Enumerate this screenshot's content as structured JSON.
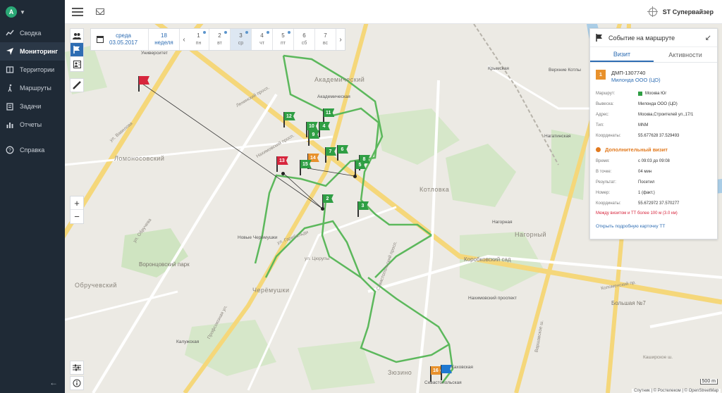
{
  "sidebar": {
    "avatar_letter": "A",
    "items": [
      {
        "label": "Сводка",
        "icon": "trend-icon"
      },
      {
        "label": "Мониторинг",
        "icon": "location-arrow-icon",
        "active": true
      },
      {
        "label": "Территории",
        "icon": "map-icon"
      },
      {
        "label": "Маршруты",
        "icon": "walker-icon"
      },
      {
        "label": "Задачи",
        "icon": "clipboard-icon"
      },
      {
        "label": "Отчеты",
        "icon": "bar-chart-icon"
      },
      {
        "label": "Справка",
        "icon": "help-icon"
      }
    ]
  },
  "topbar": {
    "user_name": "ST Супервайзер"
  },
  "date_bar": {
    "weekday": "среда",
    "date": "03.05.2017",
    "week_num": "18",
    "week_label": "неделя",
    "days": [
      {
        "num": "1",
        "name": "пн",
        "dot": true
      },
      {
        "num": "2",
        "name": "вт",
        "dot": true
      },
      {
        "num": "3",
        "name": "ср",
        "dot": true,
        "selected": true
      },
      {
        "num": "4",
        "name": "чт",
        "dot": true
      },
      {
        "num": "5",
        "name": "пт",
        "dot": true
      },
      {
        "num": "6",
        "name": "сб",
        "dot": false
      },
      {
        "num": "7",
        "name": "вс",
        "dot": false
      }
    ]
  },
  "map_labels": {
    "districts": [
      "Академический",
      "Ломоносовский",
      "Котловка",
      "Нагорный",
      "Обручевский",
      "Черёмушки",
      "Зюзино"
    ],
    "metro": [
      "Университет",
      "Академическая",
      "Новые Черёмушки",
      "Калужская",
      "Нагорная",
      "Нахимовский проспект",
      "Каховская",
      "Севастопольская",
      "Нагатинская",
      "Верхние Котлы",
      "Крымская"
    ],
    "streets": [
      "Нахимовский просп.",
      "ул. Вавилова",
      "Профсоюзная ул.",
      "Севастопольский просп.",
      "Варшавское ш.",
      "Ленинский просп.",
      "ул. Гарибальди",
      "ул. Цюрупы",
      "ул. Обручева",
      "Каширское ш.",
      "Коломенский пр."
    ],
    "parks": [
      "Воронцовский парк",
      "Коробковский сад",
      "Большая №7"
    ]
  },
  "markers": [
    {
      "label": "12",
      "color": "green"
    },
    {
      "label": "11",
      "color": "green"
    },
    {
      "label": "10",
      "color": "green"
    },
    {
      "label": "4",
      "color": "green"
    },
    {
      "label": "9",
      "color": "green"
    },
    {
      "label": "7",
      "color": "green"
    },
    {
      "label": "6",
      "color": "green"
    },
    {
      "label": "14",
      "color": "orange"
    },
    {
      "label": "13",
      "color": "red"
    },
    {
      "label": "15",
      "color": "green"
    },
    {
      "label": "8",
      "color": "green"
    },
    {
      "label": "5",
      "color": "green"
    },
    {
      "label": "2",
      "color": "green"
    },
    {
      "label": "3",
      "color": "green"
    },
    {
      "label": "16",
      "color": "orange"
    },
    {
      "label": "",
      "color": "blue"
    },
    {
      "label": "",
      "color": "red"
    }
  ],
  "panel": {
    "title": "Событие на маршруте",
    "tabs": [
      "Визит",
      "Активности"
    ],
    "tt_badge": "1",
    "tt_code": "ДМП-1307740",
    "tt_name": "Милонда ООО (ЦО)",
    "fields": [
      {
        "k": "Маршрут:",
        "v": "Москва Юг",
        "swatch": true
      },
      {
        "k": "Вывеска:",
        "v": "Милонда ООО (ЦО)"
      },
      {
        "k": "Адрес:",
        "v": "Москва,Строителей ул.,17/1"
      },
      {
        "k": "Тип:",
        "v": "MNM"
      },
      {
        "k": "Координаты:",
        "v": "55.677628   37.529493"
      }
    ],
    "section_title": "Дополнительный визит",
    "visit_fields": [
      {
        "k": "Время:",
        "v": "с 09:03 до 09:08"
      },
      {
        "k": "В точке:",
        "v": "04 мин"
      },
      {
        "k": "Результат:",
        "v": "Посетил"
      },
      {
        "k": "Номер:",
        "v": "1 (факт.)"
      },
      {
        "k": "Координаты:",
        "v": "55.672972   37.570277"
      }
    ],
    "warning": "Между визитом и ТТ более 100 м (3.0 км)",
    "link": "Открыть подробную карточку ТТ"
  },
  "scale_label": "500 m",
  "attribution": "Спутник | © Ростелеком | © OpenStreetMap"
}
